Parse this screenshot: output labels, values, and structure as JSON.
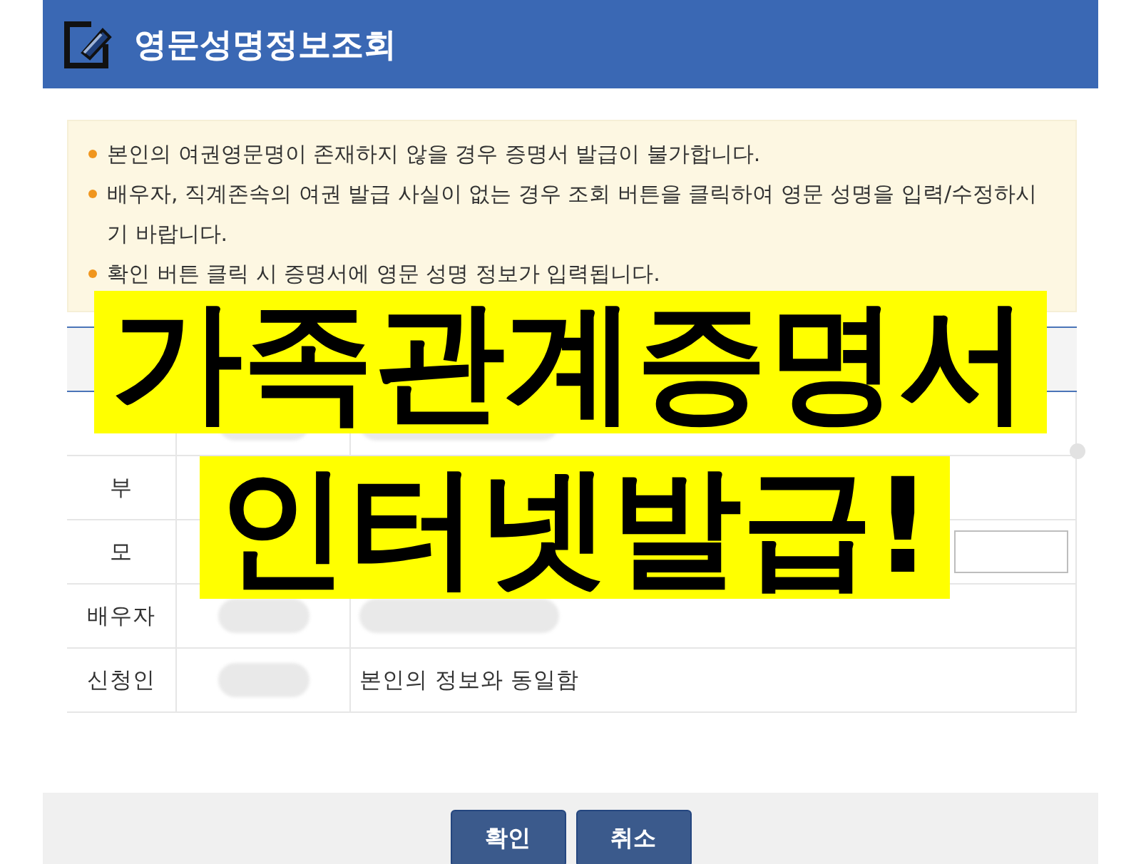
{
  "header": {
    "title": "영문성명정보조회"
  },
  "notice": {
    "items": [
      "본인의 여권영문명이 존재하지 않을 경우 증명서 발급이 불가합니다.",
      "배우자, 직계존속의 여권 발급 사실이 없는 경우 조회 버튼을 클릭하여 영문 성명을 입력/수정하시기 바랍니다.",
      "확인 버튼 클릭 시 증명서에 영문 성명 정보가 입력됩니다."
    ]
  },
  "table": {
    "rows": [
      {
        "name": {
          "kind": "blurred"
        },
        "value": {
          "kind": "blurred"
        }
      },
      {
        "label": "부"
      },
      {
        "label": "모",
        "value": {
          "kind": "input"
        }
      },
      {
        "label": "배우자",
        "name": {
          "kind": "blurred"
        },
        "value": {
          "kind": "blurred"
        }
      },
      {
        "label": "신청인",
        "name": {
          "kind": "blurred"
        },
        "value": {
          "kind": "text",
          "text": "본인의 정보와 동일함"
        }
      }
    ]
  },
  "buttons": [
    "확인",
    "취소"
  ],
  "overlay": {
    "lines": [
      "가족관계증명서",
      "인터넷발급!"
    ]
  }
}
